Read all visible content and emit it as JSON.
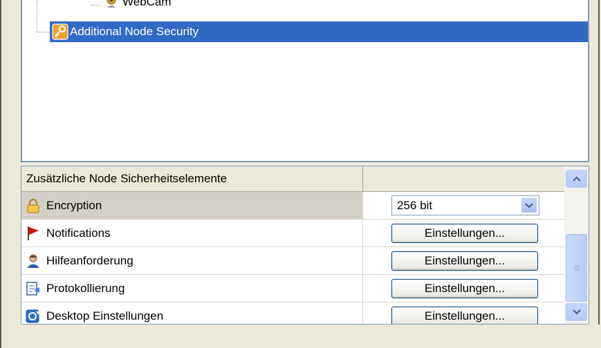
{
  "tree": {
    "partial_item": {
      "label": "WebCam",
      "icon": "webcam-icon"
    },
    "selected_item": {
      "label": "Additional Node Security",
      "icon": "key-icon"
    }
  },
  "grid": {
    "header_label": "Zusätzliche Node Sicherheitselemente",
    "rows": [
      {
        "label": "Encryption",
        "icon": "lock-icon",
        "value": "256 bit",
        "control": "dropdown"
      },
      {
        "label": "Notifications",
        "icon": "red-flag-icon",
        "button_label": "Einstellungen...",
        "control": "button"
      },
      {
        "label": "Hilfeanforderung",
        "icon": "user-icon",
        "button_label": "Einstellungen...",
        "control": "button"
      },
      {
        "label": "Protokollierung",
        "icon": "log-icon",
        "button_label": "Einstellungen...",
        "control": "button"
      },
      {
        "label": "Desktop Einstellungen",
        "icon": "desktop-settings-icon",
        "button_label": "Einstellungen...",
        "control": "button"
      }
    ]
  },
  "colors": {
    "selection": "#316ac5",
    "border": "#7f9db9",
    "background": "#ece9d8"
  }
}
